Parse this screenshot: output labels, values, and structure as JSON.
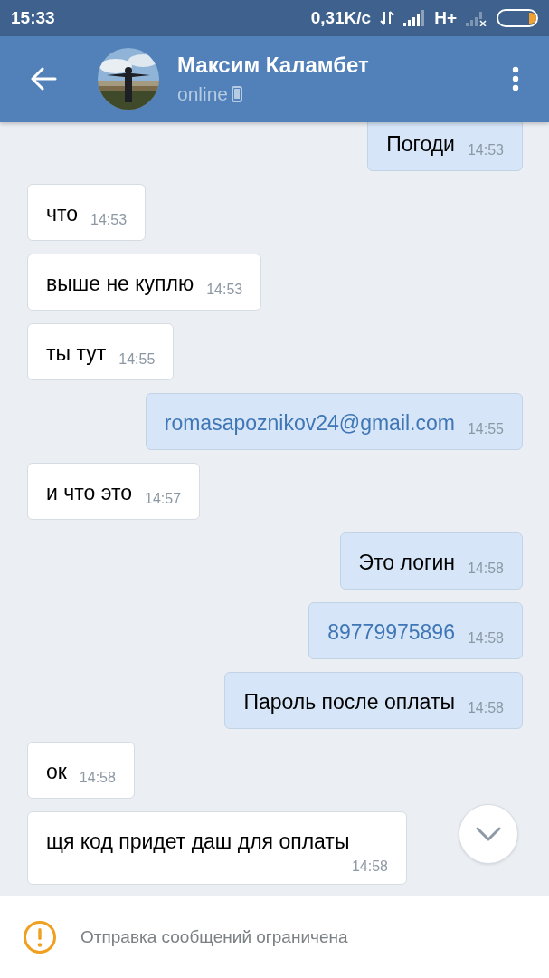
{
  "status_bar": {
    "time": "15:33",
    "speed": "0,31K/с",
    "network": "H+"
  },
  "header": {
    "name": "Максим Каламбет",
    "status": "online"
  },
  "messages": [
    {
      "outgoing": true,
      "link": false,
      "text": "Погоди",
      "time": "14:53"
    },
    {
      "outgoing": false,
      "link": false,
      "text": "что",
      "time": "14:53"
    },
    {
      "outgoing": false,
      "link": false,
      "text": "выше не куплю",
      "time": "14:53"
    },
    {
      "outgoing": false,
      "link": false,
      "text": "ты тут",
      "time": "14:55"
    },
    {
      "outgoing": true,
      "link": true,
      "text": "romasapoznikov24@gmail.com",
      "time": "14:55"
    },
    {
      "outgoing": false,
      "link": false,
      "text": "и что это",
      "time": "14:57"
    },
    {
      "outgoing": true,
      "link": false,
      "text": "Это логин",
      "time": "14:58"
    },
    {
      "outgoing": true,
      "link": true,
      "text": "89779975896",
      "time": "14:58"
    },
    {
      "outgoing": true,
      "link": false,
      "text": "Пароль после оплаты",
      "time": "14:58"
    },
    {
      "outgoing": false,
      "link": false,
      "text": "ок",
      "time": "14:58"
    },
    {
      "outgoing": false,
      "link": false,
      "text": "щя код придет даш для оплаты",
      "time": "14:58"
    }
  ],
  "notice": {
    "text": "Отправка сообщений ограничена"
  }
}
